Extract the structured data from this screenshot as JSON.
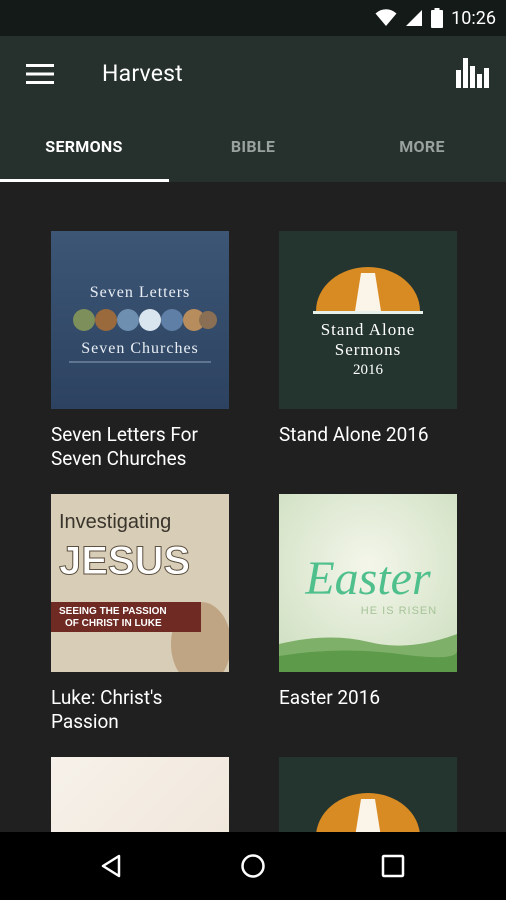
{
  "status_bar": {
    "time": "10:26"
  },
  "app_bar": {
    "title": "Harvest"
  },
  "tabs": [
    {
      "label": "SERMONS"
    },
    {
      "label": "BIBLE"
    },
    {
      "label": "MORE"
    }
  ],
  "series": [
    {
      "title": "Seven Letters For\nSeven Churches",
      "cover_text_top": "Seven Letters",
      "cover_text_bottom": "Seven Churches"
    },
    {
      "title": "Stand Alone 2016",
      "cover_line1": "Stand Alone",
      "cover_line2": "Sermons",
      "cover_line3": "2016"
    },
    {
      "title": "Luke: Christ's\nPassion",
      "cover_heading": "Investigating",
      "cover_big": "JESUS",
      "cover_banner": "SEEING THE PASSION\nOF CHRIST IN LUKE"
    },
    {
      "title": "Easter 2016",
      "cover_script": "Easter",
      "cover_sub": "HE IS RISEN"
    }
  ],
  "colors": {
    "appbar": "#26302d",
    "statusbar": "#141a18",
    "background": "#202020",
    "accent_orange": "#d88a23"
  }
}
